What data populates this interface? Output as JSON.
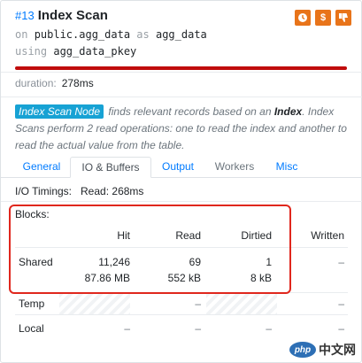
{
  "header": {
    "node_id": "#13",
    "title": "Index Scan",
    "on_kw": "on",
    "relation": "public.agg_data",
    "as_kw": "as",
    "alias": "agg_data",
    "using_kw": "using",
    "index": "agg_data_pkey",
    "icons": [
      "clock-icon",
      "dollar-icon",
      "thumbs-down-icon"
    ],
    "cost_bar_fraction": 1.0,
    "cost_bar_color": "#c00c0c"
  },
  "duration": {
    "label": "duration:",
    "value": "278ms"
  },
  "description": {
    "node_tag": "Index Scan Node",
    "part1": " finds relevant records based on an ",
    "bold": "Index",
    "part2": ". Index Scans perform 2 read operations: one to read the index and another to read the actual value from the table."
  },
  "tabs": [
    {
      "label": "General",
      "state": "link"
    },
    {
      "label": "IO & Buffers",
      "state": "active"
    },
    {
      "label": "Output",
      "state": "link"
    },
    {
      "label": "Workers",
      "state": "muted"
    },
    {
      "label": "Misc",
      "state": "link"
    }
  ],
  "io": {
    "label": "I/O Timings:",
    "read_label": "Read:",
    "read_value": "268ms"
  },
  "blocks": {
    "title": "Blocks:",
    "columns": [
      "Hit",
      "Read",
      "Dirtied",
      "Written"
    ],
    "rows": [
      {
        "label": "Shared",
        "hit": [
          "11,246",
          "87.86 MB"
        ],
        "read": [
          "69",
          "552 kB"
        ],
        "dirtied": [
          "1",
          "8 kB"
        ],
        "written": "–"
      },
      {
        "label": "Temp",
        "hit": "",
        "read": "–",
        "dirtied": "",
        "written": "–"
      },
      {
        "label": "Local",
        "hit": "–",
        "read": "–",
        "dirtied": "–",
        "written": "–"
      }
    ]
  },
  "watermark": {
    "badge": "php",
    "text": "中文网"
  },
  "colors": {
    "accent": "#007bff",
    "node_tag": "#17a2d4",
    "highlight": "#e0271d",
    "icon_bg": "#e8741a"
  }
}
